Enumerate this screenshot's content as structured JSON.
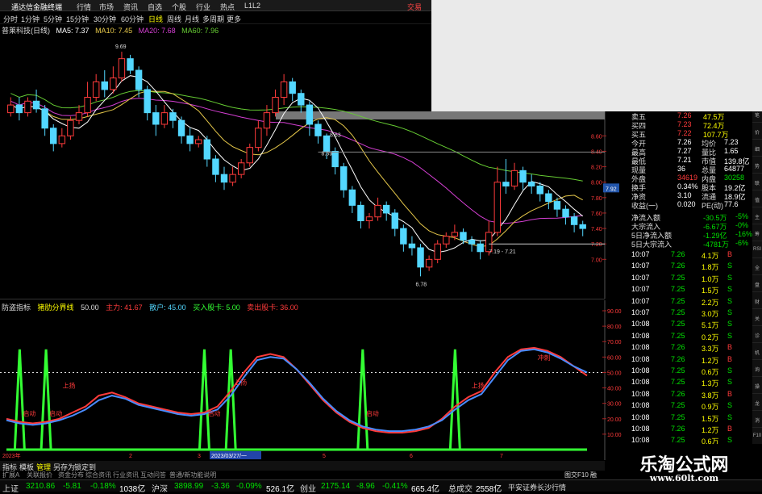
{
  "menubar": {
    "title": "通达信金融终端",
    "items": [
      "行情",
      "市场",
      "资讯",
      "自选",
      "个股",
      "行业",
      "热点",
      "L1L2"
    ],
    "right_label": "交易"
  },
  "periodbar": {
    "items": [
      "分时",
      "1分钟",
      "5分钟",
      "15分钟",
      "30分钟",
      "60分钟",
      "日线",
      "周线",
      "月线",
      "多周期",
      "更多"
    ],
    "active": "日线"
  },
  "legend1": {
    "stock": "普莱科技(日线)",
    "ma5": "MA5: 7.37",
    "ma10": "MA10: 7.45",
    "ma20": "MA20: 7.68",
    "ma60": "MA60: 7.96"
  },
  "legend2": {
    "name": "防盗指标",
    "sub": "猪肋分界线",
    "v1": "50.00",
    "v2": "主力: 41.67",
    "v3": "散户: 45.00",
    "v4": "买入股卡: 5.00",
    "v5": "卖出股卡: 36.00"
  },
  "colors": {
    "up": "#ff3b3b",
    "down": "#53d7ff",
    "ma5": "#ffffff",
    "ma10": "#e6c84a",
    "ma20": "#d53fd3",
    "ma60": "#66cc33",
    "green_bar": "#33ff33"
  },
  "chart_data": [
    {
      "type": "candlestick",
      "title": "普莱科技(日线)",
      "ylim": [
        6.7,
        9.9
      ],
      "y_ticks": [
        "8.60",
        "8.40",
        "8.20",
        "8.00",
        "7.80",
        "7.60",
        "7.40",
        "7.20",
        "7.00"
      ],
      "price_tag": "7.92",
      "annotations": [
        "9.69",
        "8.63",
        "8.39",
        "7.19 - 7.21",
        "6.78"
      ],
      "candles": [
        [
          8.9,
          9.0,
          8.85,
          9.1
        ],
        [
          9.0,
          8.9,
          8.8,
          9.1
        ],
        [
          8.9,
          9.05,
          8.85,
          9.1
        ],
        [
          9.05,
          8.95,
          8.9,
          9.2
        ],
        [
          8.95,
          8.7,
          8.6,
          9.0
        ],
        [
          8.7,
          8.5,
          8.4,
          8.75
        ],
        [
          8.5,
          8.6,
          8.45,
          8.7
        ],
        [
          8.6,
          8.8,
          8.55,
          8.85
        ],
        [
          8.8,
          8.9,
          8.75,
          9.0
        ],
        [
          8.9,
          9.1,
          8.85,
          9.3
        ],
        [
          9.1,
          9.3,
          9.05,
          9.4
        ],
        [
          9.3,
          9.2,
          9.1,
          9.45
        ],
        [
          9.2,
          9.35,
          9.15,
          9.5
        ],
        [
          9.35,
          9.6,
          9.3,
          9.69
        ],
        [
          9.6,
          9.45,
          9.4,
          9.65
        ],
        [
          9.45,
          9.2,
          9.1,
          9.5
        ],
        [
          9.2,
          8.9,
          8.8,
          9.25
        ],
        [
          8.9,
          8.75,
          8.6,
          9.0
        ],
        [
          8.75,
          8.9,
          8.7,
          9.0
        ],
        [
          8.9,
          8.8,
          8.7,
          8.95
        ],
        [
          8.8,
          8.6,
          8.5,
          8.85
        ],
        [
          8.6,
          8.5,
          8.4,
          8.7
        ],
        [
          8.5,
          8.55,
          8.45,
          8.6
        ],
        [
          8.55,
          8.3,
          8.2,
          8.6
        ],
        [
          8.3,
          8.1,
          8.0,
          8.35
        ],
        [
          8.1,
          8.0,
          7.9,
          8.2
        ],
        [
          8.0,
          8.1,
          7.95,
          8.2
        ],
        [
          8.1,
          8.25,
          8.05,
          8.3
        ],
        [
          8.25,
          8.45,
          8.2,
          8.5
        ],
        [
          8.45,
          8.7,
          8.4,
          8.8
        ],
        [
          8.7,
          8.9,
          8.6,
          9.0
        ],
        [
          8.9,
          9.1,
          8.85,
          9.2
        ],
        [
          9.1,
          9.3,
          9.0,
          9.4
        ],
        [
          9.3,
          9.15,
          9.05,
          9.35
        ],
        [
          9.15,
          9.0,
          8.9,
          9.2
        ],
        [
          9.0,
          8.75,
          8.6,
          9.05
        ],
        [
          8.75,
          8.6,
          8.5,
          8.8
        ],
        [
          8.6,
          8.4,
          8.3,
          8.63
        ],
        [
          8.4,
          8.2,
          8.1,
          8.45
        ],
        [
          8.2,
          7.9,
          7.8,
          8.25
        ],
        [
          7.9,
          7.7,
          7.6,
          7.95
        ],
        [
          7.7,
          7.5,
          7.4,
          7.75
        ],
        [
          7.5,
          7.55,
          7.4,
          7.6
        ],
        [
          7.55,
          7.7,
          7.5,
          7.8
        ],
        [
          7.7,
          7.6,
          7.5,
          7.75
        ],
        [
          7.6,
          7.4,
          7.3,
          7.65
        ],
        [
          7.4,
          7.2,
          7.1,
          7.45
        ],
        [
          7.2,
          7.15,
          7.05,
          7.3
        ],
        [
          7.15,
          6.9,
          6.78,
          7.2
        ],
        [
          6.9,
          7.0,
          6.85,
          7.05
        ],
        [
          7.0,
          7.2,
          6.95,
          7.25
        ],
        [
          7.2,
          7.3,
          7.15,
          7.35
        ],
        [
          7.3,
          7.35,
          7.25,
          7.45
        ],
        [
          7.35,
          7.25,
          7.2,
          7.4
        ],
        [
          7.25,
          7.2,
          7.1,
          7.3
        ],
        [
          7.2,
          7.1,
          7.0,
          7.25
        ],
        [
          7.1,
          7.35,
          7.05,
          7.5
        ],
        [
          7.35,
          8.0,
          7.3,
          8.2
        ],
        [
          8.0,
          7.95,
          7.85,
          8.3
        ],
        [
          7.95,
          8.15,
          7.9,
          8.25
        ],
        [
          8.15,
          8.0,
          7.9,
          8.2
        ],
        [
          8.0,
          7.95,
          7.85,
          8.1
        ],
        [
          7.95,
          7.85,
          7.75,
          8.0
        ],
        [
          7.85,
          7.75,
          7.65,
          7.9
        ],
        [
          7.75,
          7.65,
          7.55,
          7.8
        ],
        [
          7.65,
          7.55,
          7.45,
          7.7
        ],
        [
          7.55,
          7.45,
          7.35,
          7.6
        ],
        [
          7.45,
          7.4,
          7.3,
          7.5
        ]
      ]
    },
    {
      "type": "line",
      "title": "防盗指标",
      "ylim": [
        0,
        90
      ],
      "y_ticks": [
        "90.00",
        "80.00",
        "70.00",
        "60.00",
        "50.00",
        "40.00",
        "30.00",
        "20.00",
        "10.00"
      ],
      "x_labels": [
        "2023年",
        "2",
        "3",
        "2023/03/27/一",
        "5",
        "6",
        "7"
      ],
      "annotations": [
        "上扬",
        "上扬",
        "上扬",
        "冲刺",
        "启动",
        "启动",
        "启动",
        "启动"
      ],
      "threshold": 50,
      "series": [
        {
          "name": "主力",
          "values": [
            20,
            18,
            17,
            18,
            20,
            24,
            28,
            35,
            37,
            34,
            30,
            28,
            26,
            24,
            23,
            24,
            28,
            38,
            50,
            60,
            62,
            60,
            52,
            42,
            32,
            24,
            18,
            14,
            12,
            11,
            11,
            12,
            14,
            20,
            28,
            34,
            38,
            50,
            60,
            65,
            66,
            64,
            60,
            54,
            48
          ]
        },
        {
          "name": "散户",
          "values": [
            19,
            17,
            16,
            17,
            19,
            22,
            26,
            32,
            35,
            33,
            29,
            27,
            25,
            23,
            22,
            23,
            26,
            35,
            47,
            58,
            60,
            59,
            52,
            43,
            33,
            25,
            19,
            15,
            13,
            12,
            12,
            13,
            15,
            19,
            26,
            32,
            36,
            47,
            58,
            64,
            65,
            63,
            59,
            54,
            50
          ]
        }
      ],
      "spikes": [
        1,
        3,
        15,
        17,
        27,
        34
      ]
    }
  ],
  "quotes": [
    {
      "label": "卖五",
      "price": "7.26",
      "vol": "47.5万"
    },
    {
      "label": "买四",
      "price": "7.23",
      "vol": "72.4万"
    },
    {
      "label": "买五",
      "price": "7.22",
      "vol": "107.7万"
    },
    {
      "label": "今开",
      "price": "7.26",
      "k2": "均价",
      "v2": "7.23"
    },
    {
      "label": "最高",
      "price": "7.27",
      "k2": "量比",
      "v2": "1.65"
    },
    {
      "label": "最低",
      "price": "7.21",
      "k2": "市值",
      "v2": "139.8亿"
    },
    {
      "label": "现量",
      "price": "36",
      "k2": "总量",
      "v2": "64877"
    },
    {
      "label": "外盘",
      "price": "34619",
      "k2": "内盘",
      "v2": "30258"
    },
    {
      "label": "换手",
      "price": "0.34%",
      "k2": "股本",
      "v2": "19.2亿"
    },
    {
      "label": "净资",
      "price": "3.10",
      "k2": "流通",
      "v2": "18.9亿"
    },
    {
      "label": "收益(一)",
      "price": "0.020",
      "k2": "PE(动)",
      "v2": "77.6"
    }
  ],
  "flows": [
    {
      "label": "净流入额",
      "value": "-30.5万",
      "pct": "-5%"
    },
    {
      "label": "大宗流入",
      "value": "-6.67万",
      "pct": "-0%"
    },
    {
      "label": "5日净流入额",
      "value": "-1.29亿",
      "pct": "-16%"
    },
    {
      "label": "5日大宗流入",
      "value": "-4781万",
      "pct": "-6%"
    }
  ],
  "trades": [
    {
      "t": "10:07",
      "p": "7.26",
      "v": "4.1万",
      "s": "B"
    },
    {
      "t": "10:07",
      "p": "7.26",
      "v": "1.8万",
      "s": "S"
    },
    {
      "t": "10:07",
      "p": "7.25",
      "v": "1.0万",
      "s": "S"
    },
    {
      "t": "10:07",
      "p": "7.25",
      "v": "1.5万",
      "s": "S"
    },
    {
      "t": "10:07",
      "p": "7.25",
      "v": "2.2万",
      "s": "S"
    },
    {
      "t": "10:07",
      "p": "7.25",
      "v": "3.0万",
      "s": "S"
    },
    {
      "t": "10:08",
      "p": "7.25",
      "v": "5.1万",
      "s": "S"
    },
    {
      "t": "10:08",
      "p": "7.25",
      "v": "0.2万",
      "s": "S"
    },
    {
      "t": "10:08",
      "p": "7.26",
      "v": "3.3万",
      "s": "B"
    },
    {
      "t": "10:08",
      "p": "7.26",
      "v": "1.2万",
      "s": "B"
    },
    {
      "t": "10:08",
      "p": "7.25",
      "v": "0.6万",
      "s": "S"
    },
    {
      "t": "10:08",
      "p": "7.25",
      "v": "1.3万",
      "s": "S"
    },
    {
      "t": "10:08",
      "p": "7.26",
      "v": "3.8万",
      "s": "B"
    },
    {
      "t": "10:08",
      "p": "7.25",
      "v": "0.9万",
      "s": "S"
    },
    {
      "t": "10:08",
      "p": "7.25",
      "v": "1.5万",
      "s": "S"
    },
    {
      "t": "10:08",
      "p": "7.26",
      "v": "1.2万",
      "s": "B"
    },
    {
      "t": "10:08",
      "p": "7.25",
      "v": "0.6万",
      "s": "S"
    },
    {
      "t": "10:08",
      "p": "7.26",
      "v": "0.6万",
      "s": "B"
    },
    {
      "t": "10:08",
      "p": "7.26",
      "v": "1.0万",
      "s": "B"
    }
  ],
  "sidetabs": [
    "笔",
    "价",
    "细",
    "势",
    "联",
    "值",
    "主",
    "筹",
    "RSI",
    "全",
    "盘",
    "财",
    "关",
    "诊",
    "机",
    "询",
    "操",
    "龙",
    "消",
    "F10",
    "自"
  ],
  "bottomtabs": [
    "指标",
    "模板",
    "管理",
    "另存为",
    "锁定到"
  ],
  "subtabs": [
    "扩展A",
    "关联报价",
    "资金分布",
    "综合资讯",
    "行业资讯",
    "互动问答",
    "普通/新功能说明"
  ],
  "bottom_right": "图交F10 融",
  "status": {
    "sh_label": "上证",
    "sh_val": "3210.86",
    "sh_chg": "-5.81",
    "sh_pct": "-0.18%",
    "sh_amt": "1038亿",
    "sz_label": "沪深",
    "sz_val": "3898.99",
    "sz_chg": "-3.36",
    "sz_pct": "-0.09%",
    "sz_amt": "526.1亿",
    "cy_label": "创业",
    "cy_val": "2175.14",
    "cy_chg": "-8.96",
    "cy_pct": "-0.41%",
    "cy_amt": "665.4亿",
    "tot_label": "总成交",
    "tot_val": "2558亿",
    "broker": "平安证券长沙行情"
  },
  "watermark": {
    "line1": "乐淘公式网",
    "line2": "www.60lt.com"
  }
}
